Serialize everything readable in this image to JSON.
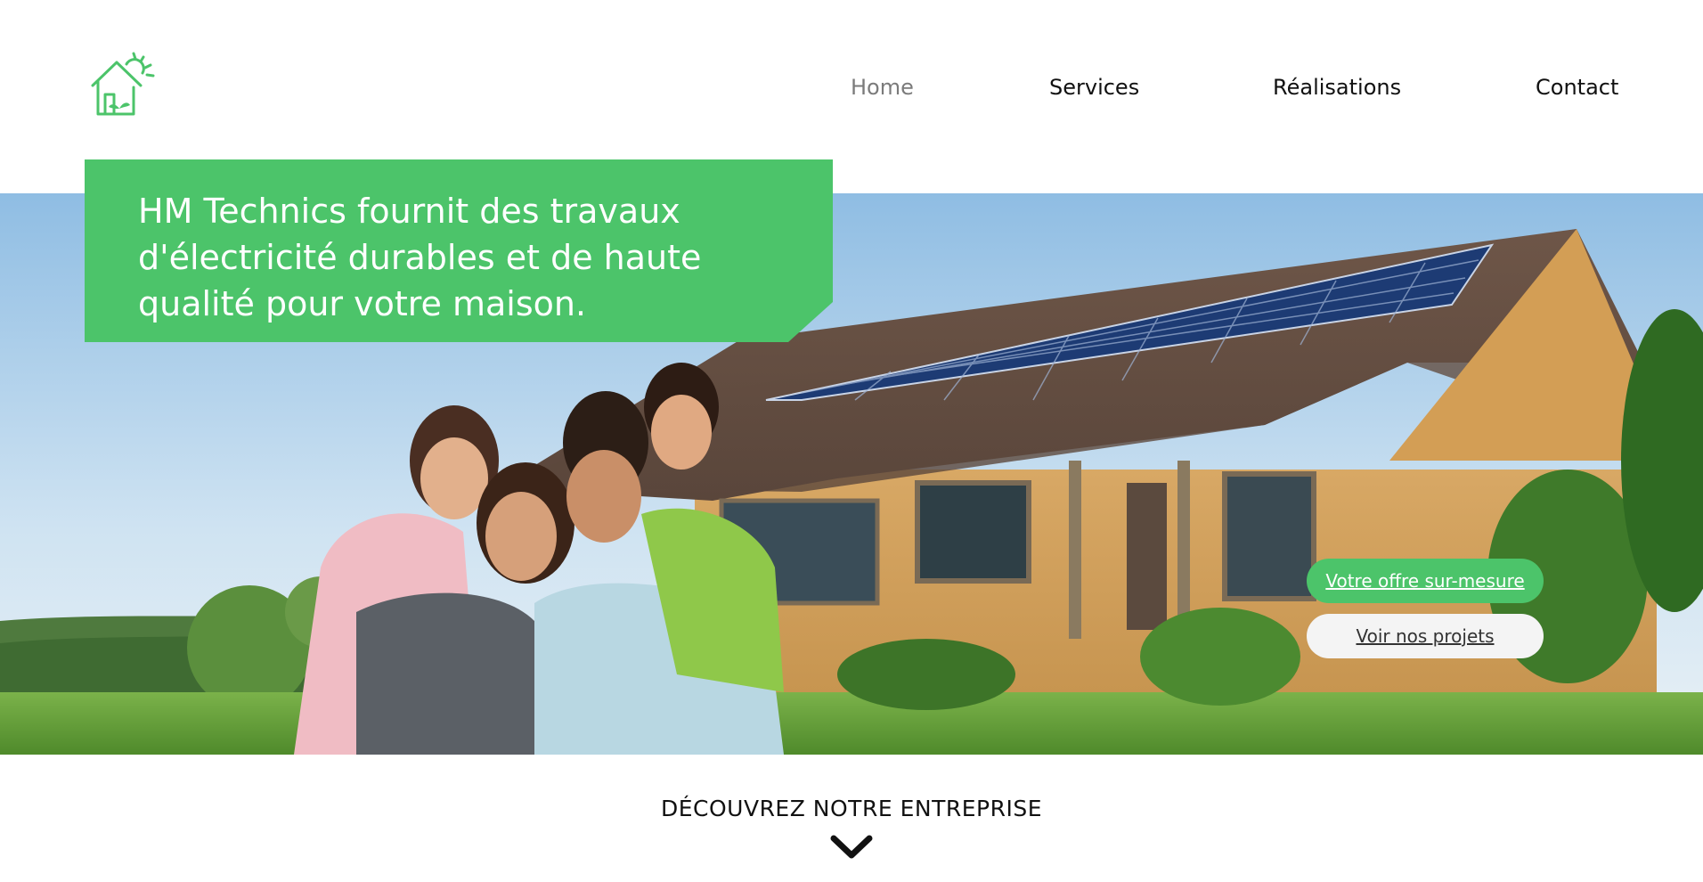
{
  "nav": {
    "home": "Home",
    "services": "Services",
    "realisations": "Réalisations",
    "contact": "Contact"
  },
  "banner": {
    "text": "HM Technics fournit des travaux d'électricité durables et de haute qualité pour votre maison."
  },
  "hero": {
    "image_description_icon": "house-with-solar-panels-family-photo"
  },
  "buttons": {
    "offer": "Votre offre sur-mesure",
    "projects": "Voir nos projets"
  },
  "discover": {
    "label": "DÉCOUVREZ NOTRE ENTREPRISE"
  },
  "colors": {
    "brand_green": "#4cc46a",
    "text": "#111111",
    "nav_active": "#7b7b7b"
  }
}
